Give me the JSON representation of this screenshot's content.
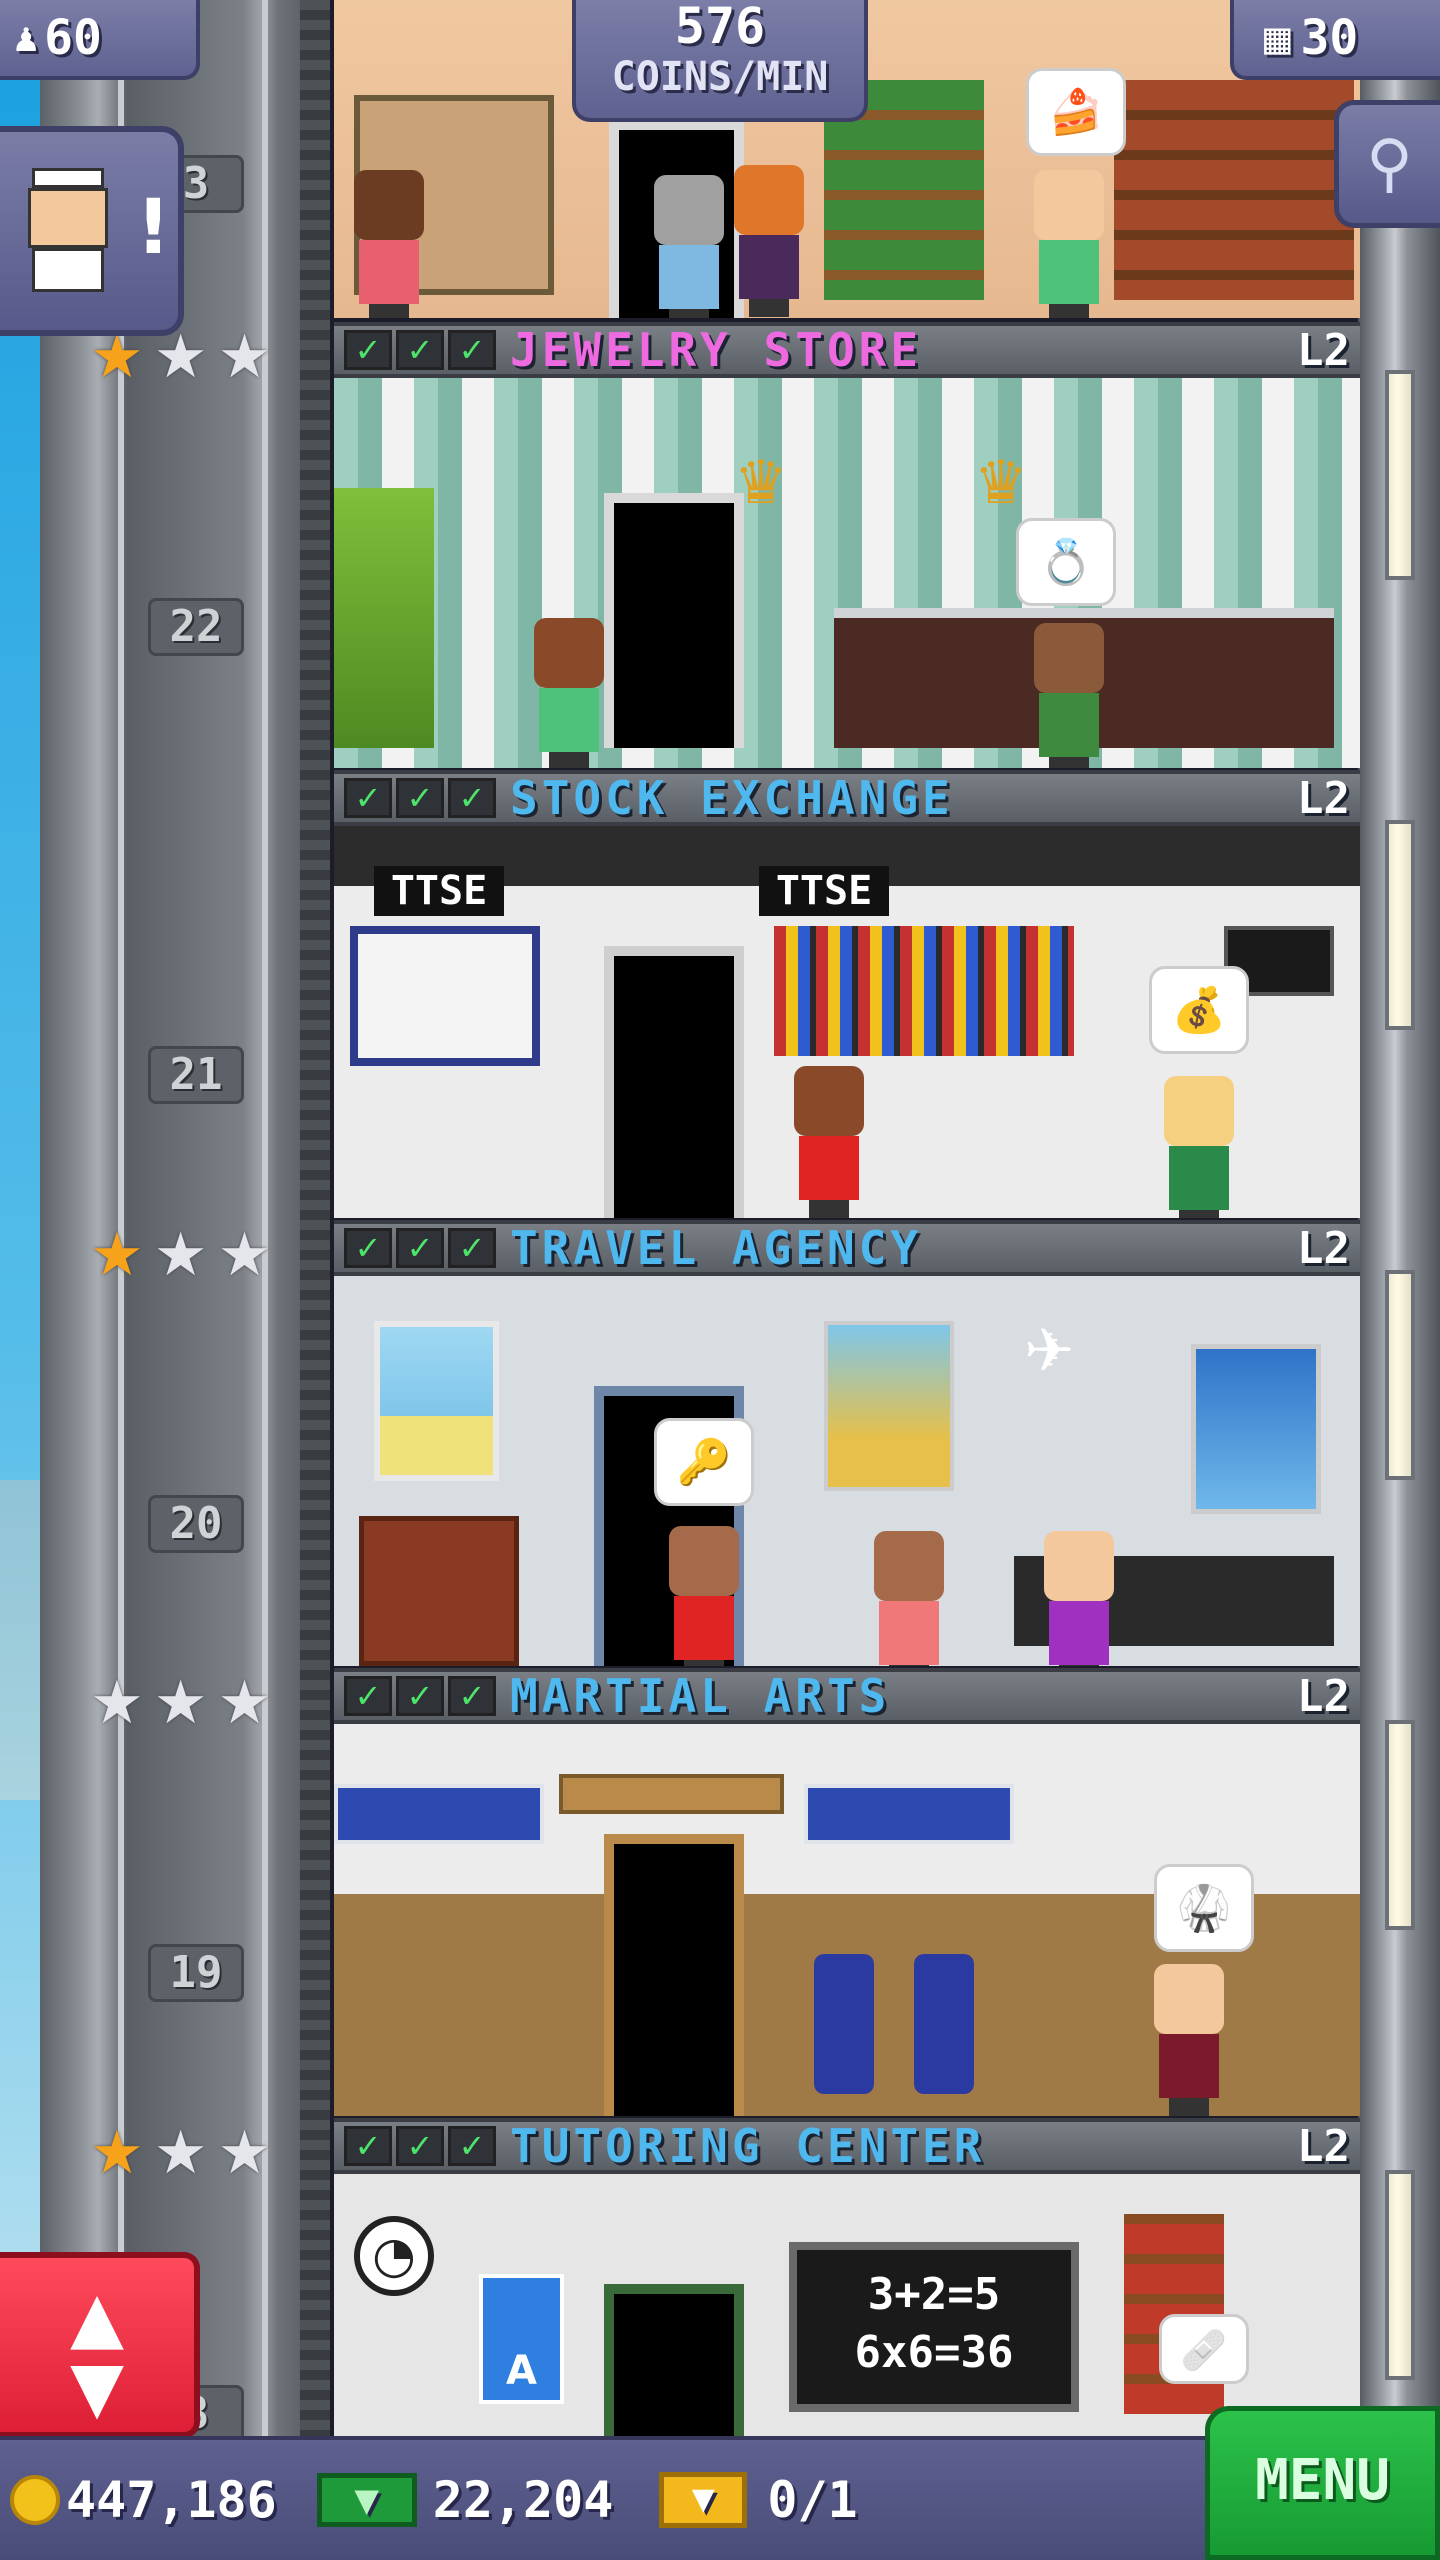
{
  "hud": {
    "population": "60",
    "coins_per_min_value": "576",
    "coins_per_min_unit": "COINS/MIN",
    "floor_count": "30"
  },
  "icons": {
    "population": "person-icon",
    "floors": "building-icon",
    "zoom": "magnifier-icon",
    "quest": "bitizen-alert-icon",
    "elevator": "up-down-arrows-icon"
  },
  "floors": [
    {
      "number": "22",
      "name": "JEWELRY STORE",
      "level": "L2",
      "name_color": "#ee6ae0",
      "stars": [
        "gold",
        "silver",
        "silver"
      ]
    },
    {
      "number": "21",
      "name": "STOCK EXCHANGE",
      "level": "L2",
      "name_color": "#4fb8ee",
      "stars": []
    },
    {
      "number": "20",
      "name": "TRAVEL AGENCY",
      "level": "L2",
      "name_color": "#4fb8ee",
      "stars": [
        "gold",
        "silver",
        "silver"
      ]
    },
    {
      "number": "19",
      "name": "MARTIAL ARTS",
      "level": "L2",
      "name_color": "#4fb8ee",
      "stars": [
        "silver",
        "silver",
        "silver"
      ]
    },
    {
      "number": "18",
      "name": "TUTORING CENTER",
      "level": "L2",
      "name_color": "#4fb8ee",
      "stars": [
        "gold",
        "silver",
        "silver"
      ]
    }
  ],
  "top_floor_number_partial": "3",
  "bottom_floor_number_partial": "8",
  "room_signs": {
    "stock_exchange": "TTSE",
    "tutoring_board_line1": "3+2=5",
    "tutoring_board_line2": "6x6=36",
    "travel_poster_letter": "A"
  },
  "bottom_bar": {
    "coins": "447,186",
    "bux": "22,204",
    "tickets": "0/1",
    "menu_label": "MENU"
  },
  "colors": {
    "hud_bg": "#6a6c9a",
    "menu_green": "#1fae3e",
    "elevator_red": "#e8263d",
    "check_green": "#4ee46a"
  }
}
